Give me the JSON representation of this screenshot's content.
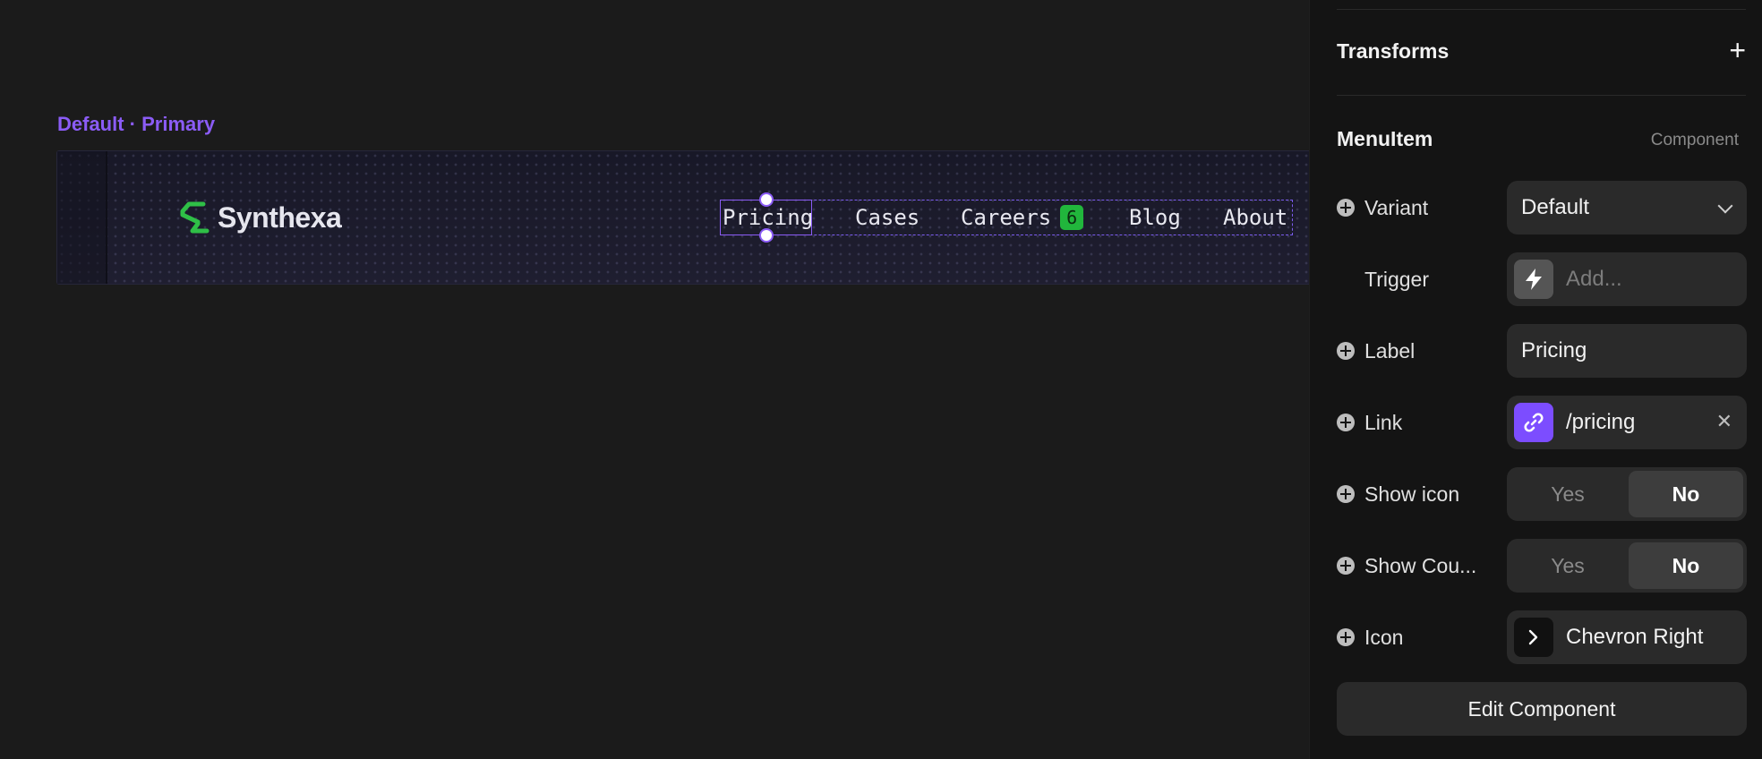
{
  "canvas": {
    "frame_label": "Default · Primary",
    "navbar": {
      "logo_text": "Synthexa",
      "menu": [
        {
          "label": "Pricing"
        },
        {
          "label": "Cases"
        },
        {
          "label": "Careers",
          "badge": "6"
        },
        {
          "label": "Blog"
        },
        {
          "label": "About"
        }
      ]
    }
  },
  "panel": {
    "transforms": {
      "title": "Transforms",
      "add_icon": "plus-icon"
    },
    "section": {
      "title": "MenuItem",
      "subtitle": "Component"
    },
    "rows": {
      "variant": {
        "label": "Variant",
        "value": "Default"
      },
      "trigger": {
        "label": "Trigger",
        "placeholder": "Add..."
      },
      "label": {
        "label": "Label",
        "value": "Pricing"
      },
      "link": {
        "label": "Link",
        "value": "/pricing"
      },
      "show_icon": {
        "label": "Show icon",
        "yes": "Yes",
        "no": "No",
        "selected": "No"
      },
      "show_count": {
        "label": "Show Cou...",
        "yes": "Yes",
        "no": "No",
        "selected": "No"
      },
      "icon": {
        "label": "Icon",
        "value": "Chevron Right"
      }
    },
    "edit_button": "Edit Component"
  },
  "colors": {
    "accent": "#8b5cf6",
    "logo_green": "#2fbf47",
    "badge_green": "#21b63c",
    "panel_bg": "#141414",
    "canvas_bg": "#1b1b1b"
  }
}
